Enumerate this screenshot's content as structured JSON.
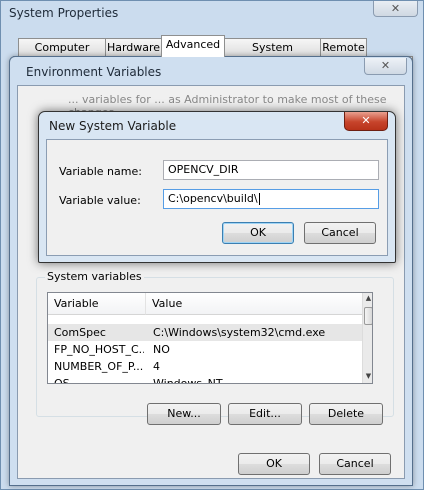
{
  "system_properties": {
    "title": "System Properties",
    "close_glyph": "✕",
    "tabs": [
      "Computer Name",
      "Hardware",
      "Advanced",
      "System Protection",
      "Remote"
    ]
  },
  "environment_variables": {
    "title": "Environment Variables",
    "close_glyph": "✕",
    "hint_text": "... variables for ... as Administrator to make most of these changes",
    "system_variables": {
      "label": "System variables",
      "columns": [
        "Variable",
        "Value"
      ],
      "rows": [
        {
          "name": "ComSpec",
          "value": "C:\\Windows\\system32\\cmd.exe"
        },
        {
          "name": "FP_NO_HOST_C...",
          "value": "NO"
        },
        {
          "name": "NUMBER_OF_P...",
          "value": "4"
        },
        {
          "name": "OS",
          "value": "Windows_NT"
        }
      ],
      "buttons": {
        "new": "New...",
        "edit": "Edit...",
        "delete": "Delete"
      }
    },
    "buttons": {
      "ok": "OK",
      "cancel": "Cancel"
    }
  },
  "new_system_variable": {
    "title": "New System Variable",
    "close_glyph": "✕",
    "name_label": "Variable name:",
    "name_value": "OPENCV_DIR",
    "value_label": "Variable value:",
    "value_value": "C:\\opencv\\build\\",
    "buttons": {
      "ok": "OK",
      "cancel": "Cancel"
    }
  },
  "icons": {
    "scroll_up": "▲",
    "scroll_down": "▼"
  }
}
